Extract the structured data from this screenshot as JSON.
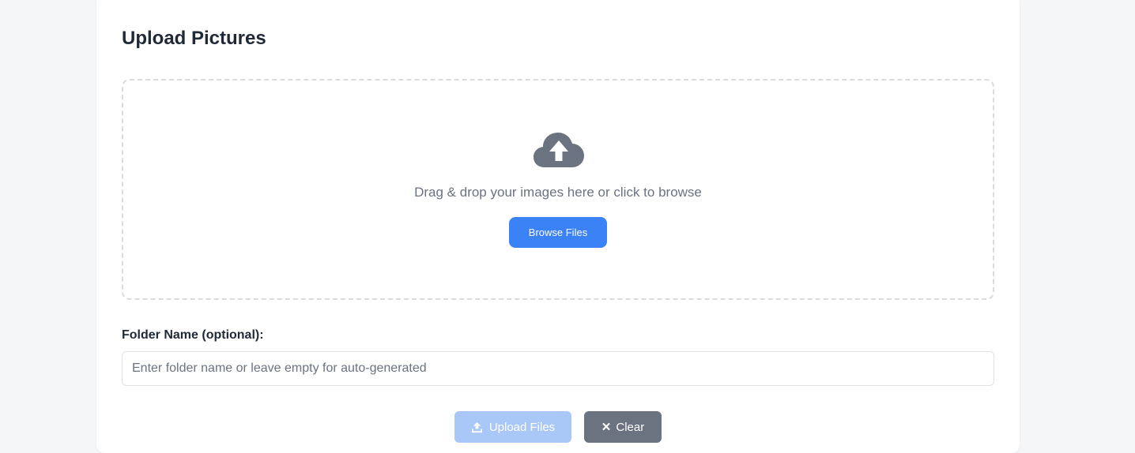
{
  "page": {
    "title": "Upload Pictures"
  },
  "dropzone": {
    "icon": "cloud-upload-icon",
    "instruction": "Drag & drop your images here or click to browse",
    "browse_label": "Browse Files"
  },
  "folder": {
    "label": "Folder Name (optional):",
    "value": "",
    "placeholder": "Enter folder name or leave empty for auto-generated"
  },
  "actions": {
    "upload_label": "Upload Files",
    "upload_icon": "upload-icon",
    "upload_enabled": false,
    "clear_label": "Clear",
    "clear_icon": "close-icon"
  },
  "colors": {
    "primary": "#3b82f6",
    "primary_disabled": "#a9c8f7",
    "secondary": "#6b7280",
    "icon_gray": "#6b7280",
    "heading": "#1f2937",
    "background": "#f5f6f8"
  }
}
